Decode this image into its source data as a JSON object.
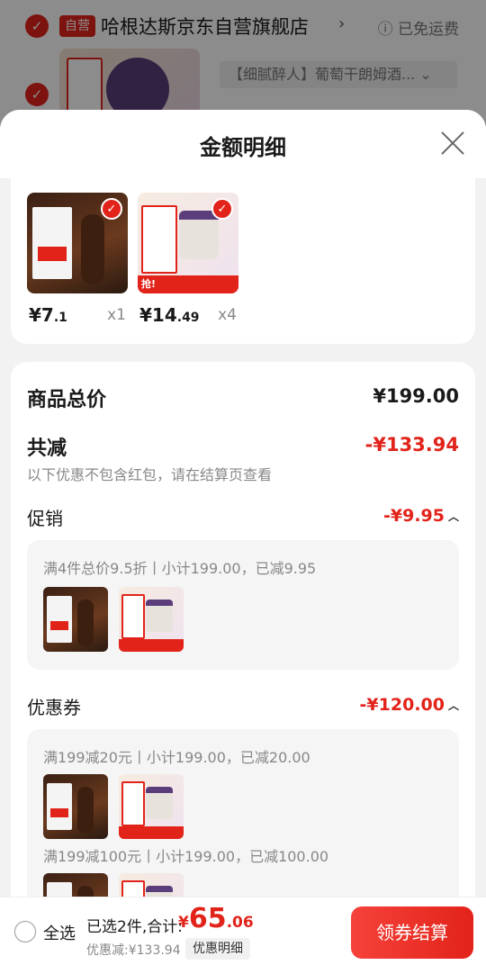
{
  "background": {
    "store_tag": "自营",
    "store_name": "哈根达斯京东自营旗舰店",
    "store_chevron": "›",
    "free_shipping": "ⓘ 已免运费",
    "spec_text": "【细腻醉人】葡萄干朗姆酒... ⌄"
  },
  "sheet": {
    "title": "金额明细",
    "close_icon": "close-icon"
  },
  "products": [
    {
      "price_int": "¥7",
      "price_dec": ".1",
      "qty": "x1"
    },
    {
      "price_int": "¥14",
      "price_dec": ".49",
      "qty": "x4"
    }
  ],
  "detail": {
    "total_label": "商品总价",
    "total_value": "¥199.00",
    "reduce_label": "共减",
    "reduce_value": "-¥133.94",
    "note": "以下优惠不包含红包，请在结算页查看",
    "promo": {
      "label": "促销",
      "value": "-¥9.95",
      "lines": [
        "满4件总价9.5折丨小计199.00，已减9.95"
      ]
    },
    "coupon": {
      "label": "优惠券",
      "value": "-¥120.00",
      "lines": [
        "满199减20元丨小计199.00，已减20.00",
        "满199减100元丨小计199.00，已减100.00"
      ]
    },
    "qiang_label": "抢!"
  },
  "bottom": {
    "select_all": "全选",
    "summary_prefix": "已选2件,合计:",
    "total_sym": "¥",
    "total_int": "65",
    "total_dec": ".06",
    "discount": "优惠减:¥133.94",
    "detail_toggle": "优惠明细",
    "checkout": "领券结算"
  },
  "colors": {
    "accent": "#e2231a",
    "muted": "#888888"
  }
}
